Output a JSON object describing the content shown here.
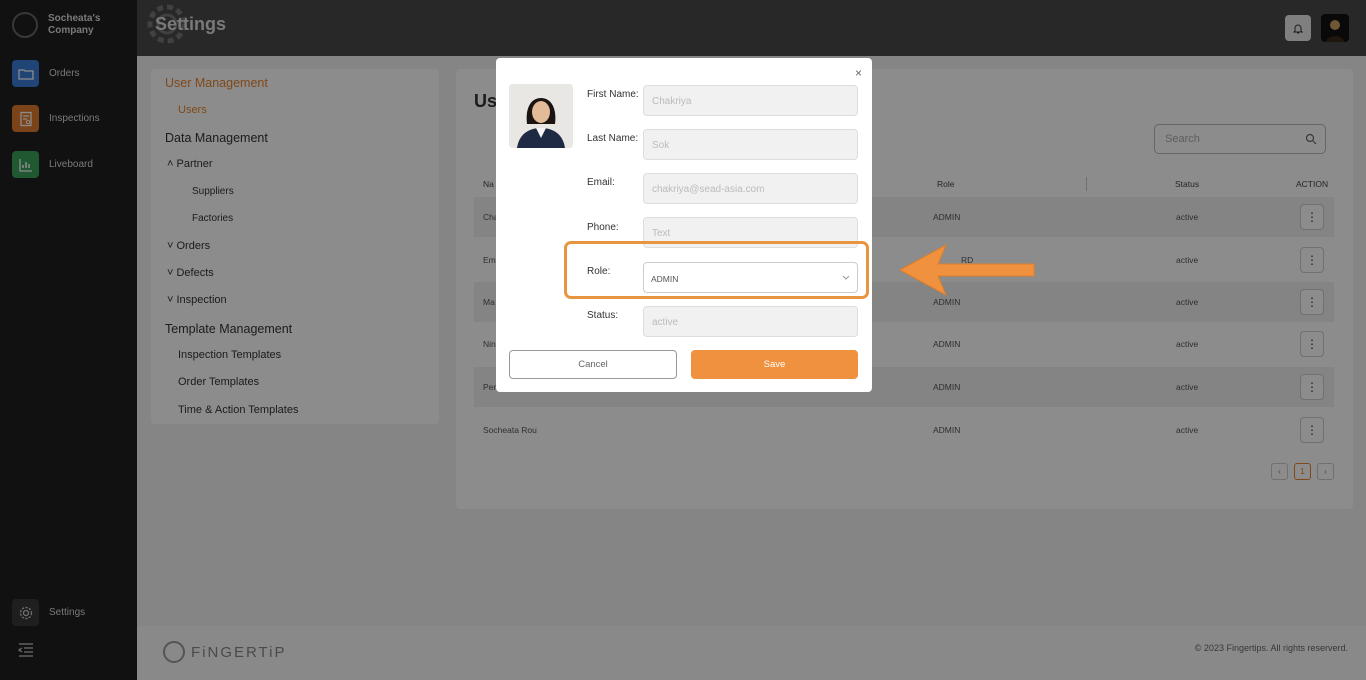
{
  "sidebar": {
    "company": "Socheata's Company",
    "items": [
      {
        "label": "Orders",
        "icon": "folder-icon",
        "color": "#3b7dd8"
      },
      {
        "label": "Inspections",
        "icon": "report-icon",
        "color": "#e07b2e"
      },
      {
        "label": "Liveboard",
        "icon": "chart-icon",
        "color": "#3aa05a"
      }
    ],
    "settings_label": "Settings"
  },
  "header": {
    "title": "Settings"
  },
  "settings_nav": {
    "user_management": "User Management",
    "users": "Users",
    "data_management": "Data Management",
    "partner": "Partner",
    "suppliers": "Suppliers",
    "factories": "Factories",
    "orders": "Orders",
    "defects": "Defects",
    "inspection": "Inspection",
    "template_management": "Template Management",
    "inspection_templates": "Inspection Templates",
    "order_templates": "Order Templates",
    "time_action_templates": "Time & Action Templates"
  },
  "users_panel": {
    "title": "Us",
    "search_placeholder": "Search",
    "columns": [
      "Na",
      "Role",
      "Status",
      "ACTION"
    ],
    "rows": [
      {
        "name": "Cha",
        "role": "ADMIN",
        "status": "active"
      },
      {
        "name": "Em",
        "role": "RD",
        "status": "active"
      },
      {
        "name": "Ma",
        "role": "ADMIN",
        "status": "active"
      },
      {
        "name": "Nin",
        "role": "ADMIN",
        "status": "active"
      },
      {
        "name": "Pen",
        "role": "ADMIN",
        "status": "active"
      },
      {
        "name": "Socheata Rou",
        "role": "ADMIN",
        "status": "active"
      }
    ],
    "pagination": {
      "prev": "‹",
      "current": "1",
      "next": "›"
    }
  },
  "modal": {
    "close": "×",
    "first_name_label": "First Name:",
    "first_name_value": "Chakriya",
    "last_name_label": "Last Name:",
    "last_name_value": "Sok",
    "email_label": "Email:",
    "email_value": "chakriya@sead-asia.com",
    "phone_label": "Phone:",
    "phone_placeholder": "Text",
    "role_label": "Role:",
    "role_value": "ADMIN",
    "status_label": "Status:",
    "status_value": "active",
    "cancel_label": "Cancel",
    "save_label": "Save"
  },
  "footer": {
    "brand": "FiNGERTiP",
    "copyright": "© 2023 Fingertips. All rights reserverd."
  },
  "colors": {
    "accent": "#f0913f",
    "highlight": "#e9953f"
  }
}
